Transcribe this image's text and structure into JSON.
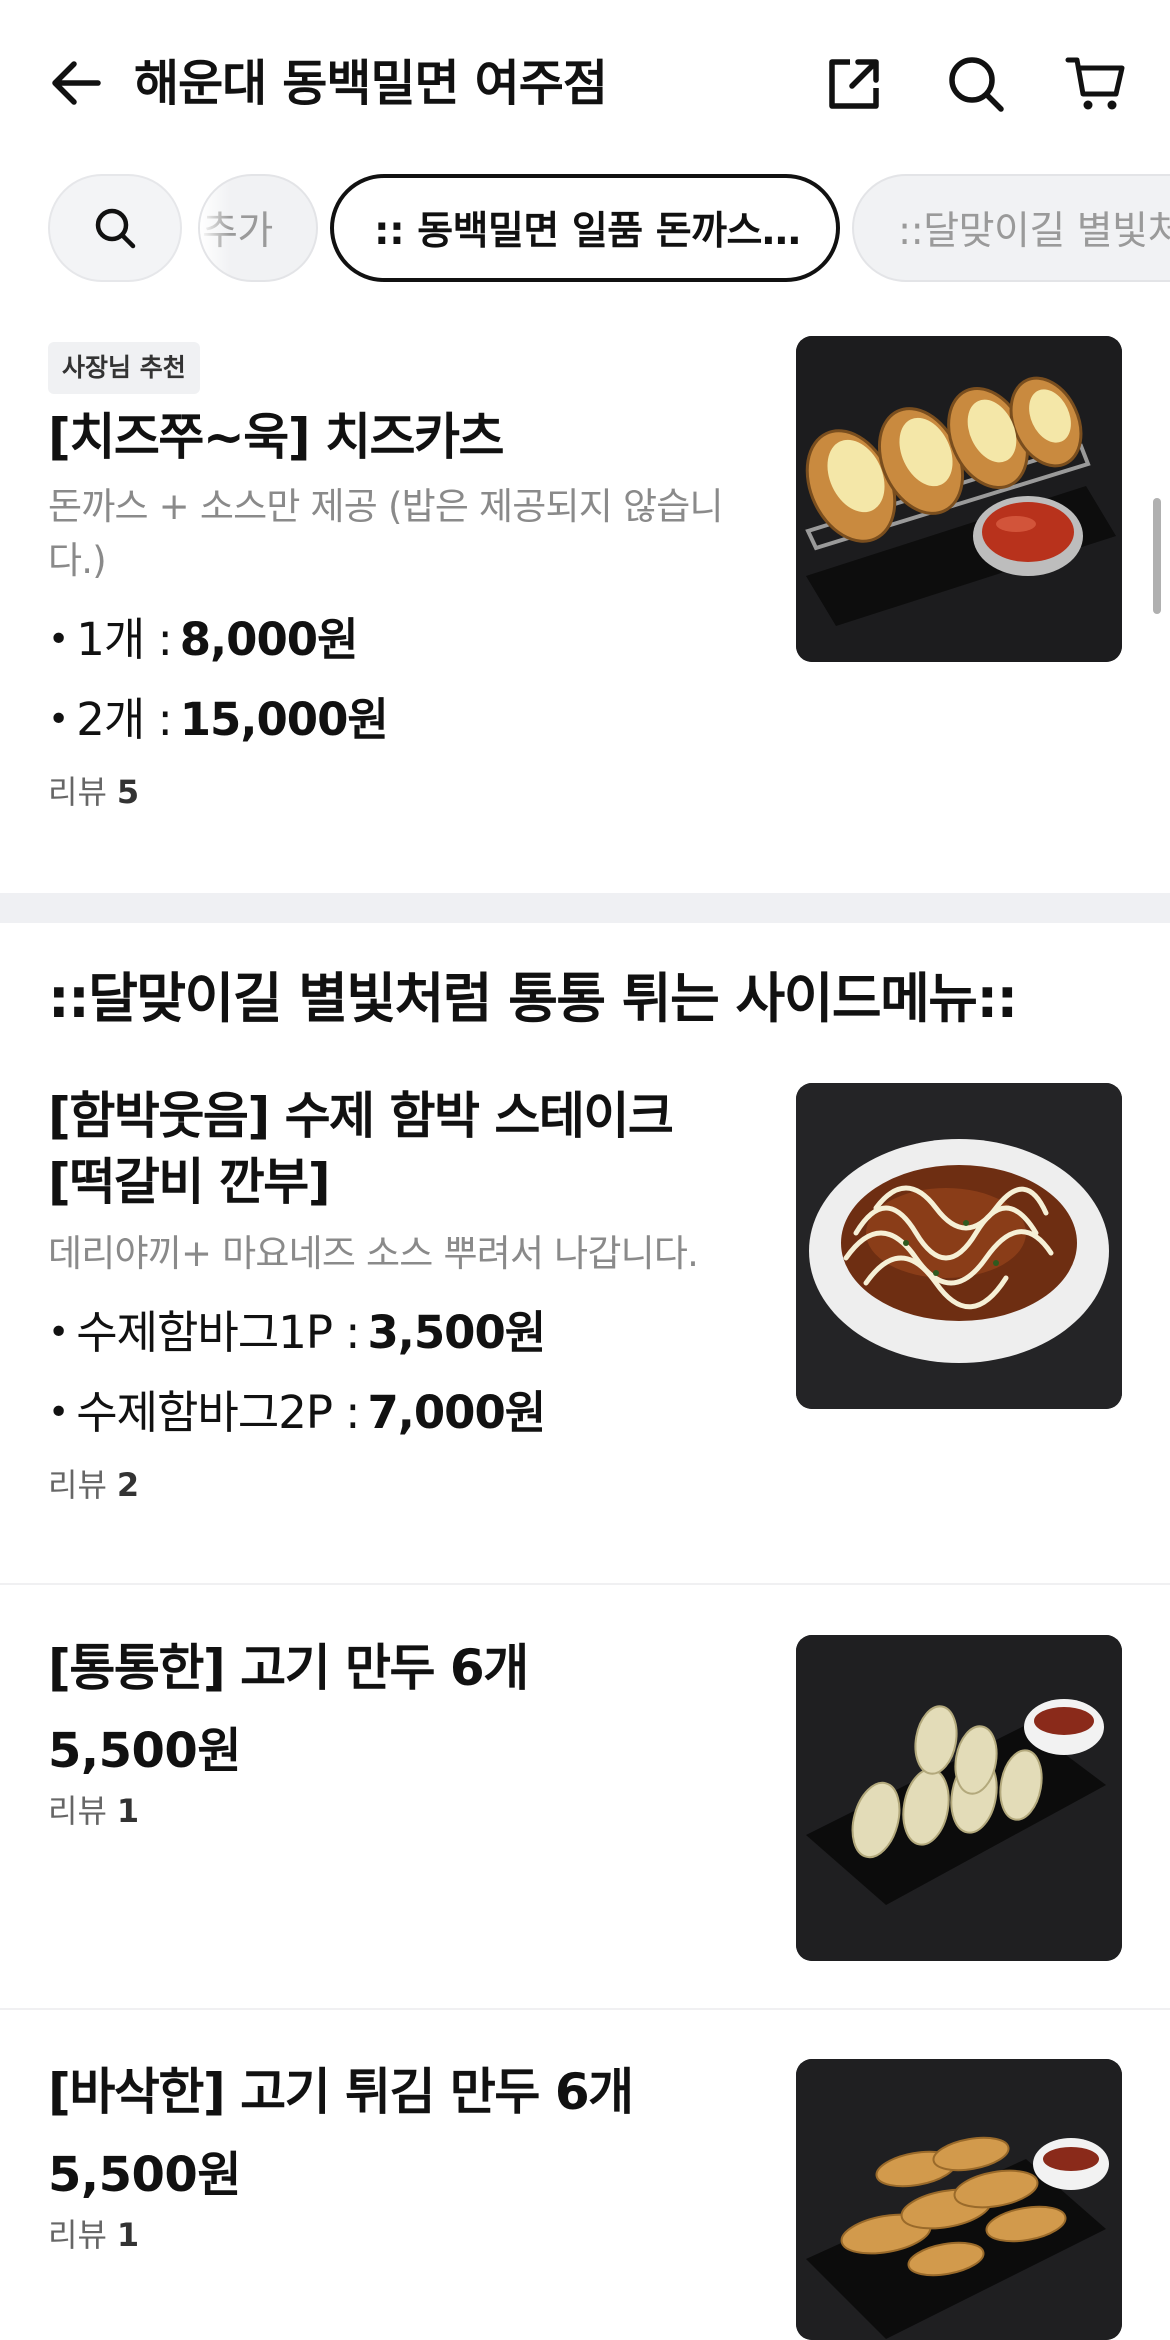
{
  "header": {
    "title": "해운대 동백밀면 여주점",
    "back_icon": "arrow-left-icon",
    "share_icon": "share-icon",
    "search_icon": "search-icon",
    "cart_icon": "cart-icon"
  },
  "categories": {
    "search_icon": "search-icon",
    "prev": "추가",
    "active": ":: 동백밀면 일품 돈까스…",
    "next": "::달맞이길 별빛처"
  },
  "items": [
    {
      "badge": "사장님 추천",
      "name": "[치즈쭈~욱] 치즈카츠",
      "desc": "돈까스 + 소스만 제공 (밥은 제공되지 않습니다.)",
      "options": [
        {
          "label": "1개 :",
          "price": "8,000원"
        },
        {
          "label": "2개 :",
          "price": "15,000원"
        }
      ],
      "review_label": "리뷰",
      "review_count": "5"
    }
  ],
  "section": {
    "title": "::달맞이길 별빛처럼 통통 튀는 사이드메뉴::"
  },
  "side_items": [
    {
      "name_line1": "[함박웃음] 수제 함박 스테이크",
      "name_line2": "[떡갈비 깐부]",
      "desc": "데리야끼+ 마요네즈 소스 뿌려서 나갑니다.",
      "options": [
        {
          "label": "수제함바그1P :",
          "price": "3,500원"
        },
        {
          "label": "수제함바그2P :",
          "price": "7,000원"
        }
      ],
      "review_label": "리뷰",
      "review_count": "2"
    },
    {
      "name": "[통통한] 고기 만두 6개",
      "price": "5,500원",
      "review_label": "리뷰",
      "review_count": "1"
    },
    {
      "name": "[바삭한] 고기 튀김 만두 6개",
      "price": "5,500원",
      "review_label": "리뷰",
      "review_count": "1"
    }
  ]
}
